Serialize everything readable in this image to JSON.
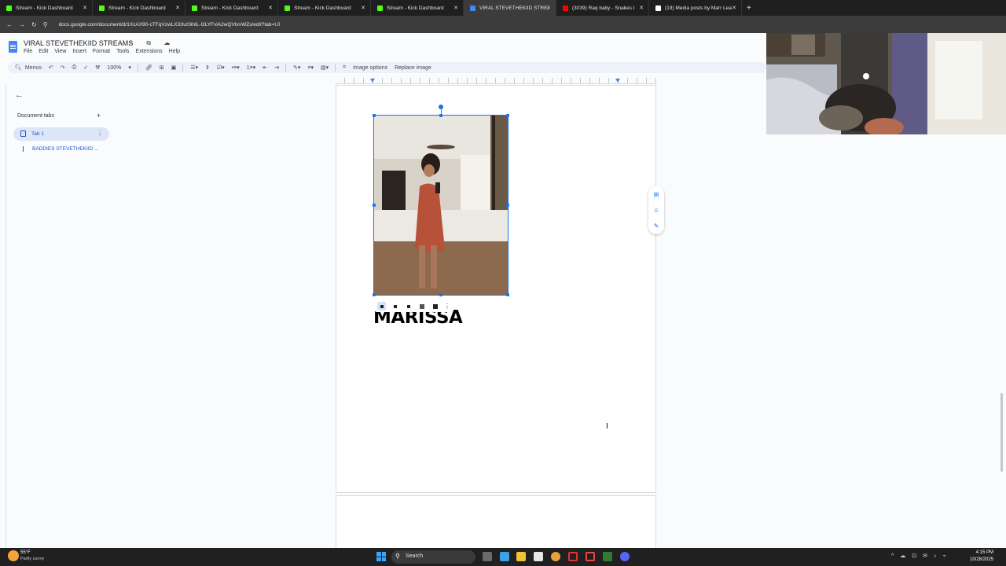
{
  "browser": {
    "tabs": [
      {
        "title": "Stream - Kick Dashboard",
        "favicon_color": "#53fc18"
      },
      {
        "title": "Stream - Kick Dashboard",
        "favicon_color": "#53fc18"
      },
      {
        "title": "Stream - Kick Dashboard",
        "favicon_color": "#53fc18"
      },
      {
        "title": "Stream - Kick Dashboard",
        "favicon_color": "#53fc18"
      },
      {
        "title": "Stream - Kick Dashboard",
        "favicon_color": "#53fc18"
      },
      {
        "title": "VIRAL STEVETHEKIID STREAMS",
        "favicon_color": "#4285f4",
        "active": true
      },
      {
        "title": "(3039) Raq baby - Snakes I",
        "favicon_color": "#ff0000"
      },
      {
        "title": "(19) Media posts by Marr Lea",
        "favicon_color": "#ffffff"
      }
    ],
    "close_glyph": "✕",
    "new_tab_glyph": "+",
    "url": "docs.google.com/document/d/1XcAX90-cTFqVzwLX33vz0ihIL-GLYFvlA2wQVtxvWZs/edit?tab=t.0"
  },
  "docs": {
    "title": "VIRAL STEVETHEKIID STREAMS",
    "title_icons": "☆ ⧉ ☁",
    "menu": [
      "File",
      "Edit",
      "View",
      "Insert",
      "Format",
      "Tools",
      "Extensions",
      "Help"
    ],
    "toolbar": {
      "menus_label": "Menus",
      "zoom": "100%",
      "image_options_label": "Image options",
      "replace_image_label": "Replace image"
    }
  },
  "sidebar": {
    "back_glyph": "←",
    "heading": "Document tabs",
    "add_glyph": "+",
    "tab_label": "Tab 1",
    "more_glyph": "⋮",
    "outline_item": "BADDIES STEVETHEKIID ..."
  },
  "document": {
    "heading_text": "MARISSA",
    "image_more_glyph": "⋮",
    "wrap_modes_selected": 0
  },
  "taskbar": {
    "weather_temp": "55°F",
    "weather_desc": "Partly sunny",
    "search_label": "Search",
    "time": "4:15 PM",
    "date": "10/28/2025"
  },
  "icons": {
    "docs": "google-docs-icon",
    "star": "star-icon",
    "move": "move-to-folder-icon",
    "cloud": "cloud-status-icon"
  }
}
